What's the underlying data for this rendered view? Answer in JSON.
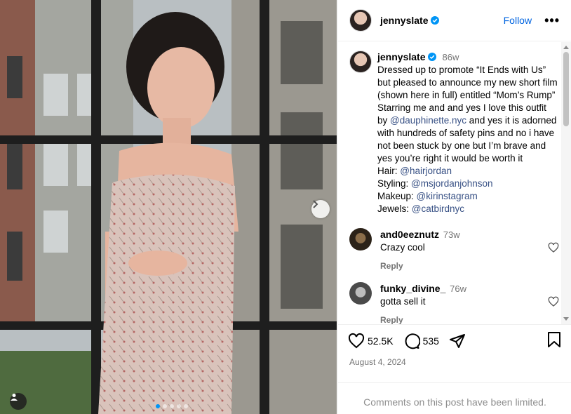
{
  "post": {
    "photo_icons": {
      "next": "chevron-right-icon",
      "tagged_users": "user-tag-icon"
    },
    "carousel": {
      "count": 5,
      "active_index": 0
    }
  },
  "header": {
    "username": "jennyslate",
    "verified_icon": "verified-badge-icon",
    "follow_label": "Follow",
    "more_label": "•••"
  },
  "caption": {
    "username": "jennyslate",
    "age": "86w",
    "text_1": "Dressed up to promote “It Ends with Us” but pleased to announce my new short film (shown here in full) entitled “Mom’s Rump” Starring me and and yes I love this outfit by ",
    "mention_1": "@dauphinette.nyc",
    "text_2": " and yes it is adorned with hundreds of safety pins and no i have not been stuck by one but I’m brave and yes you’re right it would be worth it",
    "credits": [
      {
        "label": "Hair: ",
        "handle": "@hairjordan"
      },
      {
        "label": "Styling: ",
        "handle": "@msjordanjohnson"
      },
      {
        "label": "Makeup: ",
        "handle": "@kirinstagram"
      },
      {
        "label": "Jewels: ",
        "handle": "@catbirdnyc"
      }
    ]
  },
  "comments": [
    {
      "username": "and0eeznutz",
      "age": "73w",
      "text": "Crazy cool",
      "reply_label": "Reply"
    },
    {
      "username": "funky_divine_",
      "age": "76w",
      "text": "gotta sell it",
      "reply_label": "Reply"
    }
  ],
  "actions": {
    "likes": "52.5K",
    "comments": "535",
    "icons": [
      "heart-icon",
      "comment-icon",
      "share-icon",
      "bookmark-icon"
    ]
  },
  "date": "August 4, 2024",
  "limited_notice": "Comments on this post have been limited.",
  "colors": {
    "link": "#385185",
    "follow": "#0064e0",
    "verified": "#0095f6",
    "muted": "#737373"
  }
}
